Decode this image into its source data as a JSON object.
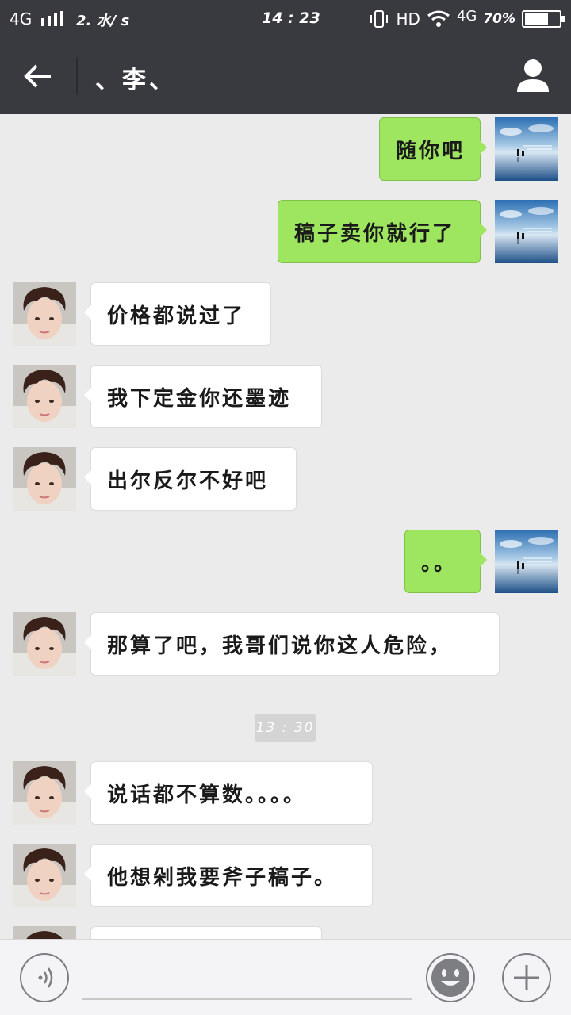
{
  "status_bar": {
    "network": "4G",
    "speed": "2. 水/ s",
    "time": "14 : 23",
    "hd": "HD",
    "network2": "4G",
    "battery_pct": "70%",
    "battery_level": 0.7
  },
  "header": {
    "title": "、李、"
  },
  "messages": [
    {
      "side": "out",
      "text": "随你吧"
    },
    {
      "side": "out",
      "text": "稿子卖你就行了"
    },
    {
      "side": "in",
      "text": "价格都说过了"
    },
    {
      "side": "in",
      "text": "我下定金你还墨迹"
    },
    {
      "side": "in",
      "text": "出尔反尔不好吧"
    },
    {
      "side": "out",
      "text": "。。"
    },
    {
      "side": "in",
      "text": "那算了吧，我哥们说你这人危险，"
    },
    {
      "side": "in",
      "text": "说话都不算数。。。。"
    },
    {
      "side": "in",
      "text": "他想剁我要斧子稿子。"
    },
    {
      "side": "in",
      "text": ""
    }
  ],
  "timestamp": "13 : 30",
  "input_bar": {
    "placeholder": ""
  },
  "colors": {
    "bar_bg": "#393a3f",
    "chat_bg": "#ebebeb",
    "out_bubble": "#9ee65f",
    "in_bubble": "#ffffff"
  }
}
